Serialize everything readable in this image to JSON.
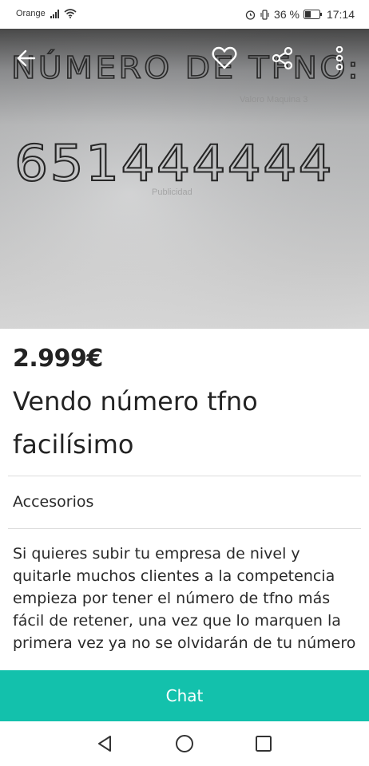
{
  "status_bar": {
    "carrier": "Orange",
    "battery": "36 %",
    "time": "17:14"
  },
  "photo": {
    "handwritten_heading": "NÚMERO DE TFNO:",
    "handwritten_number": "651444444",
    "faint_text_1": "Valoro Maquina 3",
    "faint_text_2": "Publicidad"
  },
  "topbar": {
    "icons": [
      "back-arrow-icon",
      "heart-icon",
      "share-icon",
      "more-vertical-icon"
    ]
  },
  "listing": {
    "price": "2.999€",
    "title": "Vendo número tfno facilísimo",
    "category": "Accesorios",
    "description": "Si quieres subir tu empresa de nivel y quitarle muchos clientes a la competencia empieza por tener el número de tfno más fácil de retener, una vez que lo marquen la primera vez ya no se olvidarán de tu número"
  },
  "chat_button": {
    "label": "Chat"
  },
  "colors": {
    "accent": "#13c1ac",
    "text": "#232323",
    "divider": "#dcdcdc"
  },
  "nav_bar": {
    "icons": [
      "back-triangle-icon",
      "home-circle-icon",
      "recents-square-icon"
    ]
  }
}
